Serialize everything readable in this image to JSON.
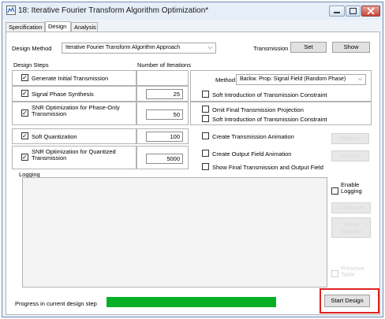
{
  "window": {
    "title": "18: Iterative Fourier Transform Algorithm Optimization*"
  },
  "tabs": [
    {
      "label": "Specification"
    },
    {
      "label": "Design"
    },
    {
      "label": "Analysis"
    }
  ],
  "design_method": {
    "label": "Design Method",
    "value": "Iterative Fourier Transform Algorithm Approach",
    "transmission_label": "Transmission",
    "set_label": "Set",
    "show_label": "Show"
  },
  "headers": {
    "design_steps": "Design Steps",
    "num_iterations": "Number of Iterations"
  },
  "steps": {
    "generate": "Generate Initial Transmission",
    "phase_synthesis": "Signal Phase Synthesis",
    "phase_synthesis_iter": "25",
    "snr_phase_only": "SNR Optimization for Phase-Only Transmission",
    "snr_phase_only_iter": "50",
    "soft_quant": "Soft Quantization",
    "soft_quant_iter": "100",
    "snr_quant": "SNR Optimization for Quantized Transmission",
    "snr_quant_iter": "5000"
  },
  "method": {
    "label": "Method",
    "value": "Backw. Prop. Signal Field (Random Phase)"
  },
  "options_right": {
    "soft_intro_1": "Soft Introduction of Transmission Constraint",
    "omit_final": "Omit Final Transmission Projection",
    "soft_intro_2": "Soft Introduction of Transmission Constraint",
    "create_trans_anim": "Create Transmission Animation",
    "create_output_anim": "Create Output Field Animation",
    "show_final": "Show Final Transmission and Output Field",
    "options1": "Options",
    "options2": "Options"
  },
  "logging": {
    "label": "Logging",
    "enable": "Enable Logging",
    "configure": "Configure",
    "show_diagram": "Show Diagram",
    "preserve_table": "Preserve Table"
  },
  "footer": {
    "progress_label": "Progress in current design step",
    "progress": 1.0,
    "start_design": "Start Design"
  }
}
